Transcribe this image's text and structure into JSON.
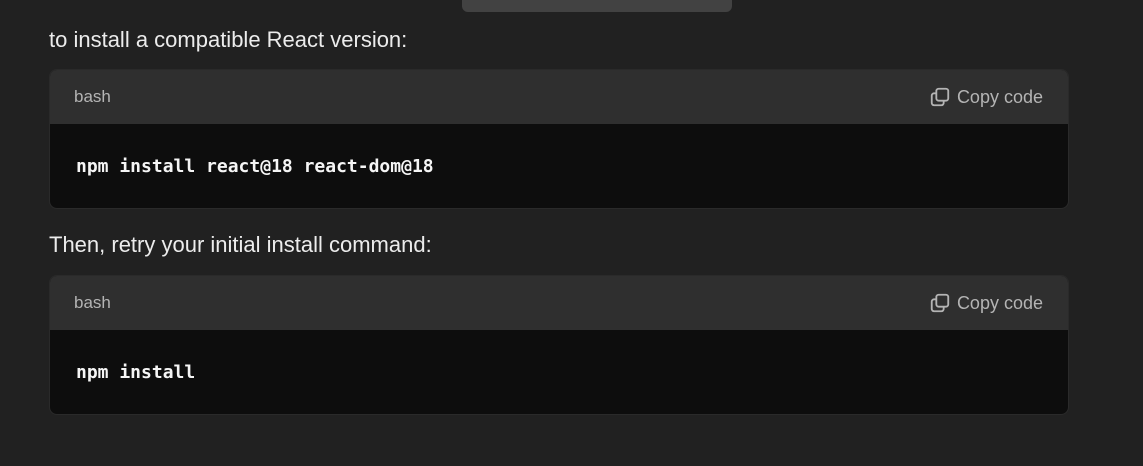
{
  "paragraphs": {
    "intro": "to install a compatible React version:",
    "then": "Then, retry your initial install command:"
  },
  "code_blocks": [
    {
      "language": "bash",
      "copy_label": "Copy code",
      "code": "npm install react@18 react-dom@18"
    },
    {
      "language": "bash",
      "copy_label": "Copy code",
      "code": "npm install"
    }
  ],
  "icons": {
    "copy": "copy-icon"
  },
  "colors": {
    "background": "#212121",
    "header": "#2f2f2f",
    "code_bg": "#0d0d0d",
    "muted_text": "#b4b4b4"
  }
}
